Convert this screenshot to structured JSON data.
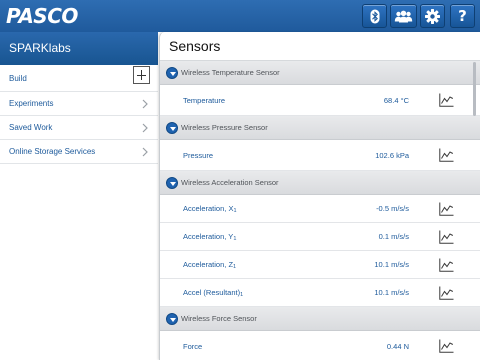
{
  "app": {
    "logo_text": "PASCO",
    "toolbar": {
      "bluetooth_icon": "bluetooth-icon",
      "users_icon": "users-icon",
      "settings_icon": "gear-icon",
      "help_label": "?"
    }
  },
  "sidebar": {
    "title": "SPARKlabs",
    "items": [
      {
        "label": "Build",
        "icon": "add-box-icon"
      },
      {
        "label": "Experiments",
        "icon": "chevron-right-icon"
      },
      {
        "label": "Saved Work",
        "icon": "chevron-right-icon"
      },
      {
        "label": "Online Storage Services",
        "icon": "chevron-right-icon"
      }
    ]
  },
  "panel": {
    "title": "Sensors",
    "groups": [
      {
        "name": "Wireless Temperature Sensor",
        "rows": [
          {
            "measurement": "Temperature",
            "subscript": "",
            "value": "68.4 °C"
          }
        ]
      },
      {
        "name": "Wireless Pressure Sensor",
        "rows": [
          {
            "measurement": "Pressure",
            "subscript": "",
            "value": "102.6 kPa"
          }
        ]
      },
      {
        "name": "Wireless Acceleration Sensor",
        "rows": [
          {
            "measurement": "Acceleration, X",
            "subscript": "1",
            "value": "-0.5 m/s/s"
          },
          {
            "measurement": "Acceleration, Y",
            "subscript": "1",
            "value": "0.1 m/s/s"
          },
          {
            "measurement": "Acceleration, Z",
            "subscript": "1",
            "value": "10.1 m/s/s"
          },
          {
            "measurement": "Accel (Resultant)",
            "subscript": "1",
            "value": "10.1 m/s/s"
          }
        ]
      },
      {
        "name": "Wireless Force Sensor",
        "rows": [
          {
            "measurement": "Force",
            "subscript": "",
            "value": "0.44 N"
          }
        ]
      }
    ]
  },
  "colors": {
    "topbar": "#1f5a9c",
    "link_text": "#1d5a9b",
    "group_header_bg": "#dedfe2",
    "toggle": "#1f63b0"
  }
}
